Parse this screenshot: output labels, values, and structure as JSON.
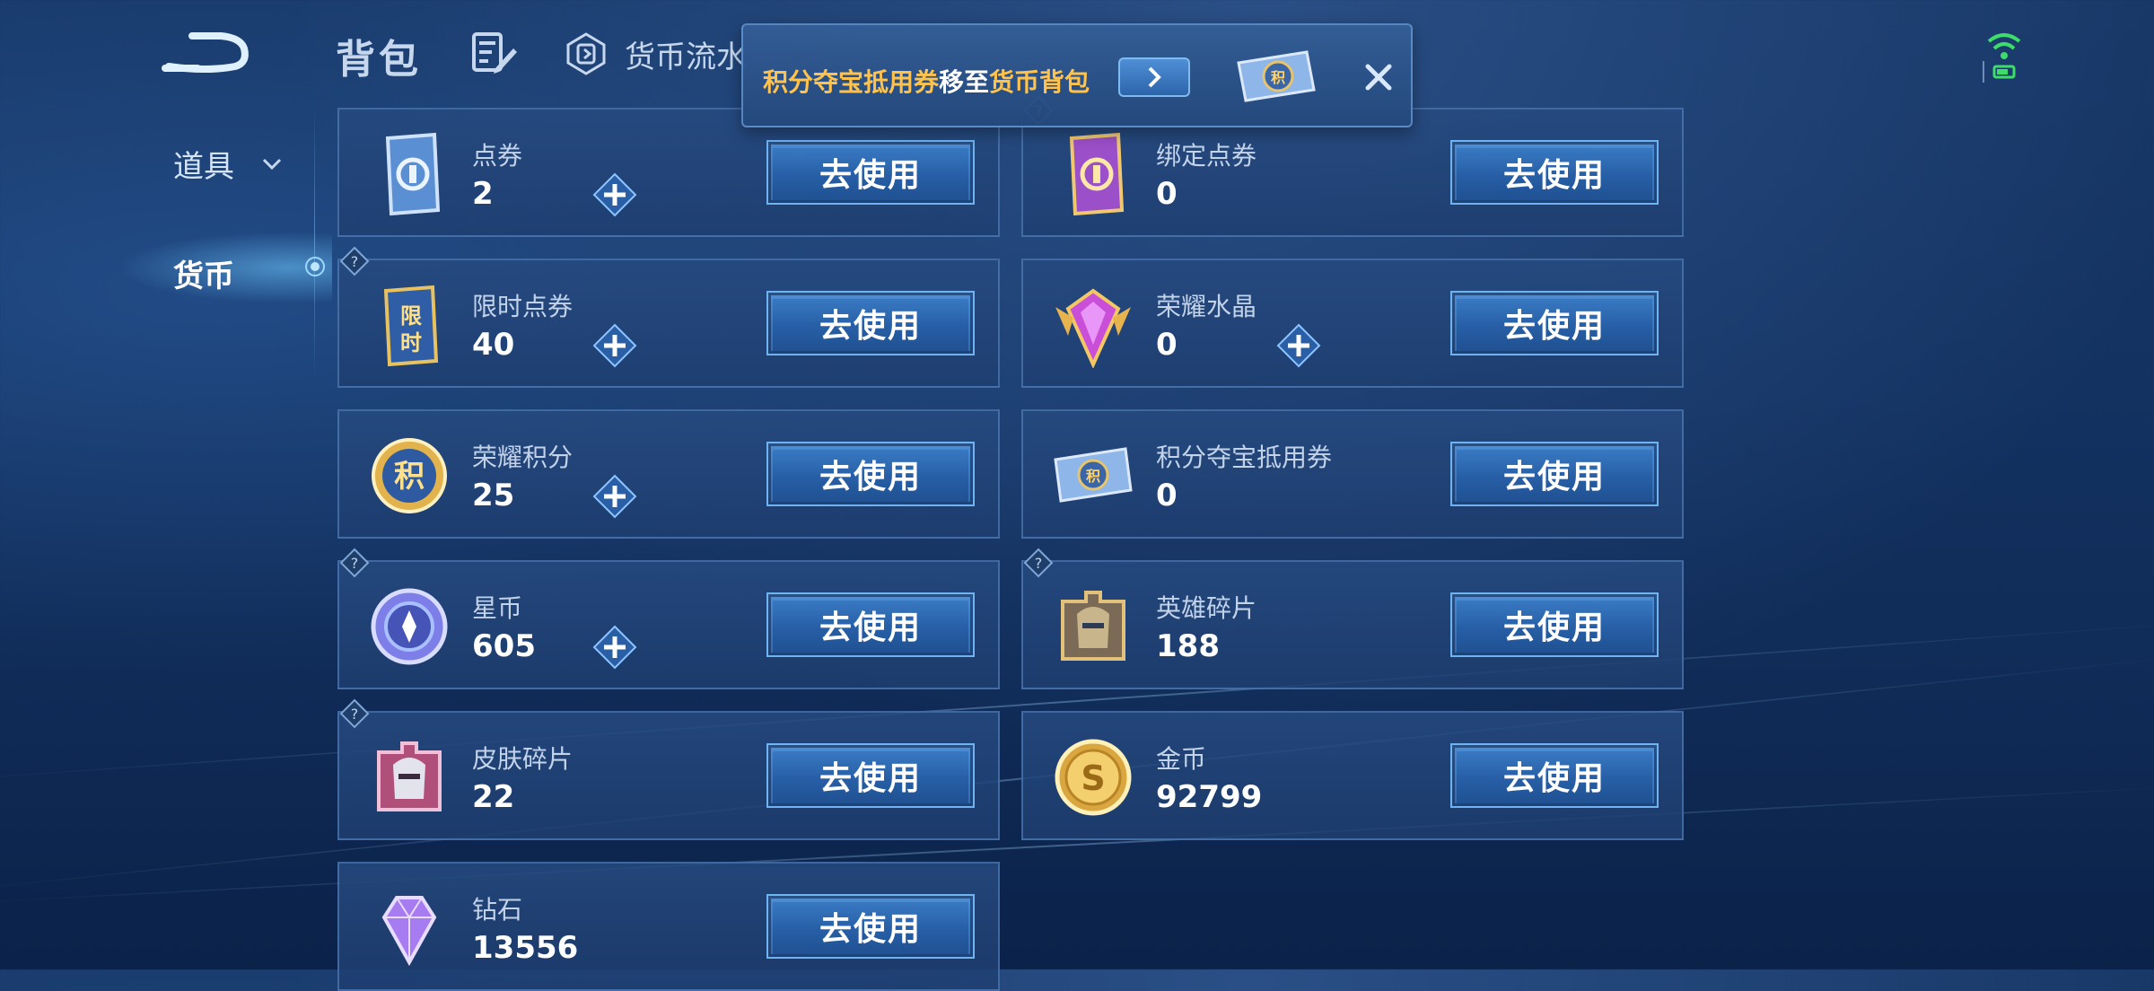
{
  "header": {
    "title": "背包",
    "ledger_label": "货币流水"
  },
  "sidebar": {
    "items": [
      {
        "label": "道具",
        "state": "collapsed"
      },
      {
        "label": "货币",
        "state": "selected"
      }
    ]
  },
  "toast": {
    "part1": "积分夺宝抵用券",
    "part2": "移至",
    "part3": "货币背包"
  },
  "currencies": [
    {
      "name": "点券",
      "count": "2",
      "button": "去使用",
      "has_plus": true,
      "has_help": false,
      "icon": "coupon-icon"
    },
    {
      "name": "绑定点券",
      "count": "0",
      "button": "去使用",
      "has_plus": false,
      "has_help": true,
      "icon": "bound-coupon-icon"
    },
    {
      "name": "限时点券",
      "count": "40",
      "button": "去使用",
      "has_plus": true,
      "has_help": true,
      "icon": "limited-coupon-icon"
    },
    {
      "name": "荣耀水晶",
      "count": "0",
      "button": "去使用",
      "has_plus": true,
      "has_help": false,
      "icon": "glory-crystal-icon"
    },
    {
      "name": "荣耀积分",
      "count": "25",
      "button": "去使用",
      "has_plus": true,
      "has_help": false,
      "icon": "glory-points-icon"
    },
    {
      "name": "积分夺宝抵用券",
      "count": "0",
      "button": "去使用",
      "has_plus": false,
      "has_help": false,
      "icon": "points-voucher-icon"
    },
    {
      "name": "星币",
      "count": "605",
      "button": "去使用",
      "has_plus": true,
      "has_help": true,
      "icon": "star-coin-icon"
    },
    {
      "name": "英雄碎片",
      "count": "188",
      "button": "去使用",
      "has_plus": false,
      "has_help": true,
      "icon": "hero-fragment-icon"
    },
    {
      "name": "皮肤碎片",
      "count": "22",
      "button": "去使用",
      "has_plus": false,
      "has_help": true,
      "icon": "skin-fragment-icon"
    },
    {
      "name": "金币",
      "count": "92799",
      "button": "去使用",
      "has_plus": false,
      "has_help": false,
      "icon": "gold-coin-icon"
    },
    {
      "name": "钻石",
      "count": "13556",
      "button": "去使用",
      "has_plus": false,
      "has_help": false,
      "icon": "diamond-icon"
    }
  ]
}
